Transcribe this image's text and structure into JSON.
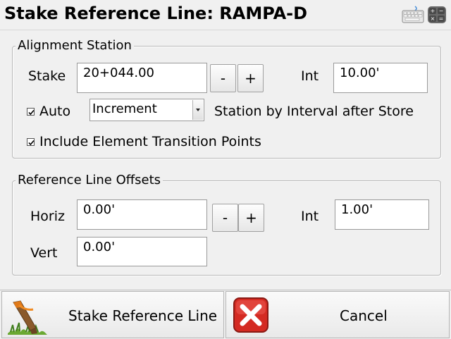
{
  "window": {
    "title": "Stake Reference Line: RAMPA-D"
  },
  "icons": {
    "keyboard": "keyboard-icon",
    "calculator": "calculator-icon",
    "stake": "survey-stake-icon",
    "cancel": "red-x-icon"
  },
  "alignment_station": {
    "legend": "Alignment Station",
    "stake_label": "Stake",
    "stake_value": "20+044.00",
    "minus": "-",
    "plus": "+",
    "int_label": "Int",
    "int_value": "10.00'",
    "auto_label": "Auto",
    "auto_checked": true,
    "mode_value": "Increment",
    "station_note": "Station by Interval after Store",
    "include_label": "Include Element Transition Points",
    "include_checked": true
  },
  "reference_offsets": {
    "legend": "Reference Line Offsets",
    "horiz_label": "Horiz",
    "horiz_value": "0.00'",
    "minus": "-",
    "plus": "+",
    "int_label": "Int",
    "int_value": "1.00'",
    "vert_label": "Vert",
    "vert_value": "0.00'"
  },
  "footer": {
    "stake_button": "Stake Reference Line",
    "cancel_button": "Cancel"
  },
  "colors": {
    "background": "#f0f0f0",
    "cancel_red": "#d42a22"
  }
}
